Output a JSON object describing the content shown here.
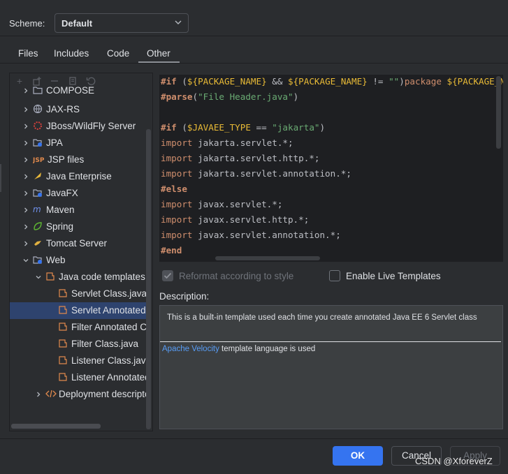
{
  "scheme": {
    "label": "Scheme:",
    "value": "Default"
  },
  "tabs": [
    {
      "label": "Files"
    },
    {
      "label": "Includes"
    },
    {
      "label": "Code"
    },
    {
      "label": "Other",
      "active": true
    }
  ],
  "toolbar_icons": [
    "add-icon",
    "add-child-icon",
    "remove-icon",
    "copy-icon",
    "reset-icon"
  ],
  "tree": [
    {
      "label": "COMPOSE",
      "icon": "folder-icon",
      "expanded": false
    },
    {
      "label": "JAX-RS",
      "icon": "globe-icon",
      "expanded": false
    },
    {
      "label": "JBoss/WildFly Server",
      "icon": "jboss-icon",
      "expanded": false
    },
    {
      "label": "JPA",
      "icon": "jpa-folder-icon",
      "expanded": false
    },
    {
      "label": "JSP files",
      "icon": "jsp-icon",
      "expanded": false
    },
    {
      "label": "Java Enterprise",
      "icon": "java-ee-icon",
      "expanded": false
    },
    {
      "label": "JavaFX",
      "icon": "javafx-folder-icon",
      "expanded": false
    },
    {
      "label": "Maven",
      "icon": "maven-icon",
      "expanded": false
    },
    {
      "label": "Spring",
      "icon": "spring-icon",
      "expanded": false
    },
    {
      "label": "Tomcat Server",
      "icon": "tomcat-icon",
      "expanded": false
    },
    {
      "label": "Web",
      "icon": "web-folder-icon",
      "expanded": true
    },
    {
      "label": "Java code templates",
      "icon": "template-icon",
      "expanded": true
    },
    {
      "label": "Servlet Class.java",
      "icon": "template-icon"
    },
    {
      "label": "Servlet Annotated",
      "icon": "template-icon",
      "selected": true
    },
    {
      "label": "Filter Annotated Cl",
      "icon": "template-icon"
    },
    {
      "label": "Filter Class.java",
      "icon": "template-icon"
    },
    {
      "label": "Listener Class.java",
      "icon": "template-icon"
    },
    {
      "label": "Listener Annotated",
      "icon": "template-icon"
    },
    {
      "label": "Deployment descripto",
      "icon": "xml-icon",
      "expanded": false
    }
  ],
  "code": {
    "line1": {
      "d": "#if",
      "p1": " (",
      "v1": "${PACKAGE_NAME}",
      "p2": " && ",
      "v2": "${PACKAGE_NAME}",
      "p3": " != ",
      "s": "\"\"",
      "p4": ")",
      "k": "package",
      "p5": " ",
      "v3": "${PACKAGE_NAME}"
    },
    "line2": {
      "d": "#parse",
      "p1": "(",
      "s": "\"File Header.java\"",
      "p2": ")"
    },
    "line4": {
      "d": "#if",
      "p1": " (",
      "v": "$JAVAEE_TYPE",
      "p2": " == ",
      "s": "\"jakarta\"",
      "p3": ")"
    },
    "line5": {
      "k": "import",
      "t": " jakarta.servlet.*;"
    },
    "line6": {
      "k": "import",
      "t": " jakarta.servlet.http.*;"
    },
    "line7": {
      "k": "import",
      "t": " jakarta.servlet.annotation.*;"
    },
    "line8": {
      "d": "#else"
    },
    "line9": {
      "k": "import",
      "t": " javax.servlet.*;"
    },
    "line10": {
      "k": "import",
      "t": " javax.servlet.http.*;"
    },
    "line11": {
      "k": "import",
      "t": " javax.servlet.annotation.*;"
    },
    "line12": {
      "d": "#end"
    }
  },
  "options": {
    "reformat_label": "Reformat according to style",
    "reformat_checked": true,
    "reformat_enabled": false,
    "live_templates_label": "Enable Live Templates",
    "live_templates_checked": false
  },
  "description": {
    "label": "Description:",
    "text": "This is a built-in template used each time you create annotated Java EE 6 Servlet class",
    "link_text": "Apache Velocity",
    "footer_text": " template language is used"
  },
  "buttons": {
    "ok": "OK",
    "cancel": "Cancel",
    "apply": "Apply"
  },
  "watermark": "CSDN @XforeverZ",
  "colors": {
    "accent": "#3574f0",
    "selection": "#2e436e",
    "link": "#589df6"
  }
}
